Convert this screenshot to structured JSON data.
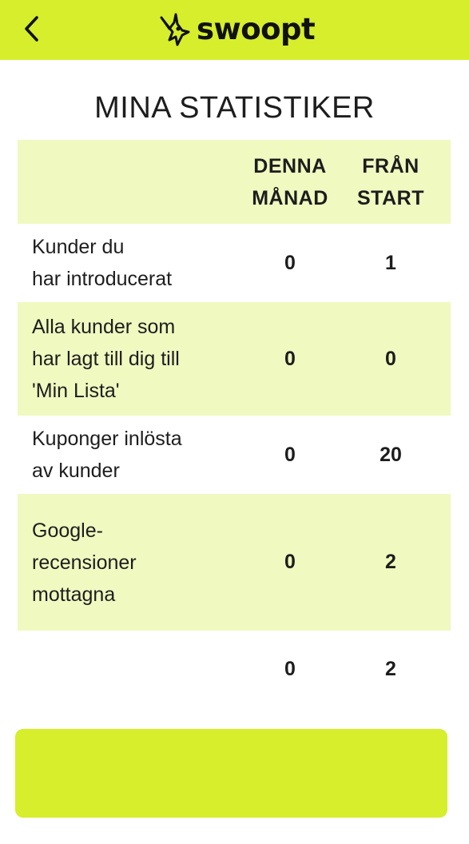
{
  "header": {
    "back_icon": "chevron-left-icon",
    "logo_icon": "swoopt-bird-icon",
    "logo_text": "swoopt",
    "background": "#d6ee2b"
  },
  "page_title": "MINA STATISTIKER",
  "table": {
    "columns": [
      "DENNA\nMÅNAD",
      "FRÅN\nSTART"
    ],
    "rows": [
      {
        "label": "Kunder du\nhar introducerat",
        "this_month": "0",
        "since_start": "1"
      },
      {
        "label": "Alla kunder som\nhar lagt till dig till\n'Min Lista'",
        "this_month": "0",
        "since_start": "0"
      },
      {
        "label": "Kuponger inlösta\nav kunder",
        "this_month": "0",
        "since_start": "20"
      },
      {
        "label": "Google-\nrecensioner\nmottagna",
        "this_month": "0",
        "since_start": "2"
      },
      {
        "label": "",
        "this_month": "0",
        "since_start": "2"
      }
    ],
    "shade_color": "#f0f9c0"
  },
  "bottom_button": {
    "label": "",
    "background": "#d6ee2b"
  }
}
